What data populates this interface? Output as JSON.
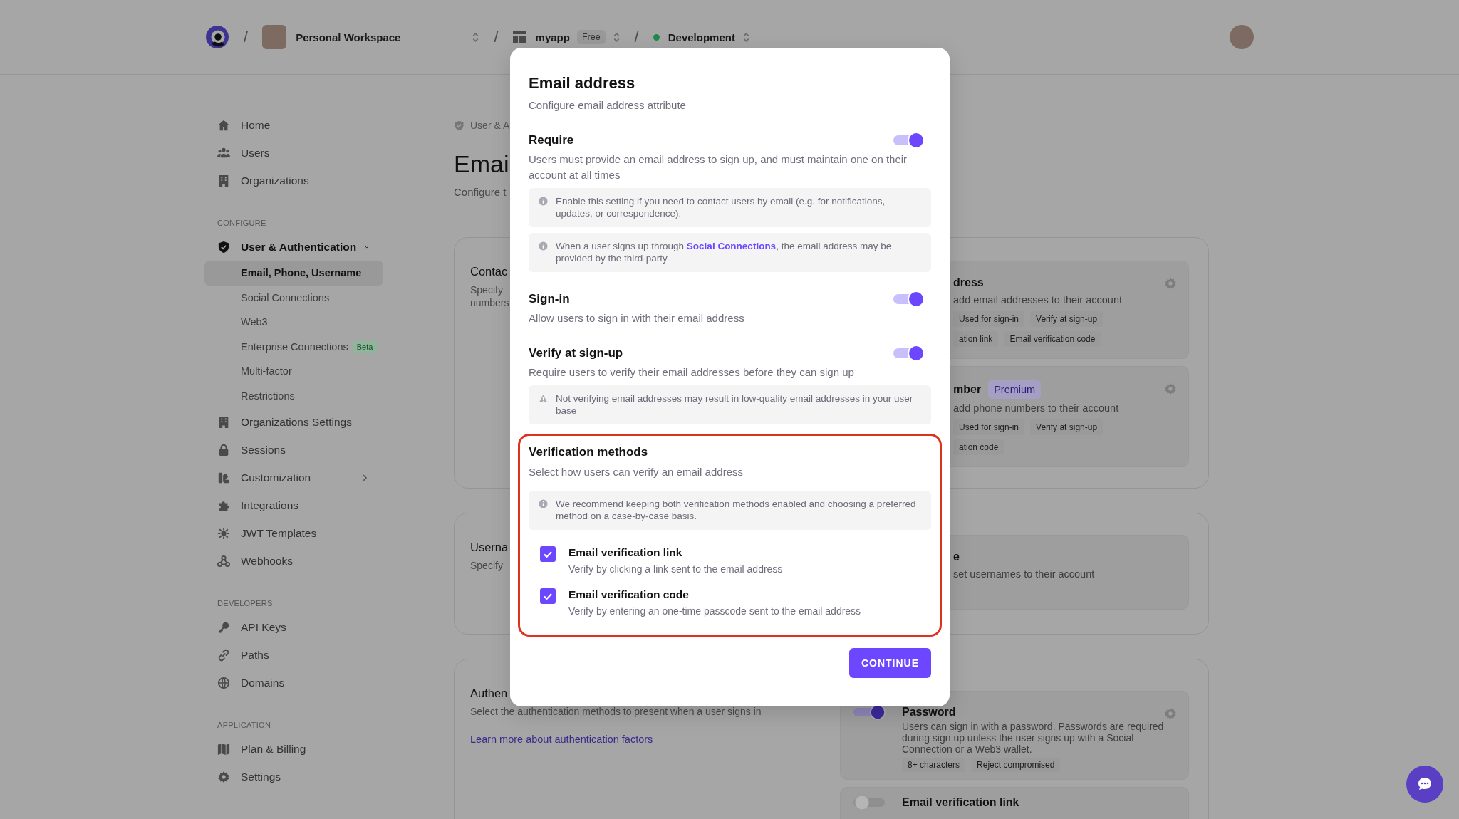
{
  "top_bar": {
    "separators": [
      "/",
      "/",
      "/"
    ],
    "workspace": "Personal Workspace",
    "app": "myapp",
    "plan_badge": "Free",
    "environment": "Development"
  },
  "sidebar": {
    "groups": [
      {
        "items": [
          {
            "label": "Home",
            "selected": false
          },
          {
            "label": "Users",
            "selected": false
          },
          {
            "label": "Organizations",
            "selected": false
          }
        ]
      },
      {
        "heading": "CONFIGURE",
        "items": [
          {
            "label": "User & Authentication",
            "selected": false,
            "expanded": true,
            "children": [
              {
                "label": "Email, Phone, Username",
                "selected": true
              },
              {
                "label": "Social Connections",
                "selected": false
              },
              {
                "label": "Web3",
                "selected": false
              },
              {
                "label": "Enterprise Connections",
                "selected": false,
                "badge": "Beta"
              },
              {
                "label": "Multi-factor",
                "selected": false
              },
              {
                "label": "Restrictions",
                "selected": false
              }
            ]
          },
          {
            "label": "Organizations Settings",
            "selected": false
          },
          {
            "label": "Sessions",
            "selected": false
          },
          {
            "label": "Customization",
            "selected": false,
            "expanded": false
          },
          {
            "label": "Integrations",
            "selected": false
          },
          {
            "label": "JWT Templates",
            "selected": false
          },
          {
            "label": "Webhooks",
            "selected": false
          }
        ]
      },
      {
        "heading": "DEVELOPERS",
        "items": [
          {
            "label": "API Keys",
            "selected": false
          },
          {
            "label": "Paths",
            "selected": false
          },
          {
            "label": "Domains",
            "selected": false
          }
        ]
      },
      {
        "heading": "APPLICATION",
        "items": [
          {
            "label": "Plan & Billing",
            "selected": false
          },
          {
            "label": "Settings",
            "selected": false
          }
        ]
      }
    ]
  },
  "page": {
    "breadcrumb": "User & A",
    "title": "Emai",
    "subtitle": "Configure t",
    "cards": [
      {
        "title": "Contac",
        "description_lines": [
          "Specify",
          "numbers"
        ],
        "settings": [
          {
            "kind": "cut",
            "title": "dress",
            "description": "add email addresses to their account",
            "tag_rows": [
              [
                "Used for sign-in",
                "Verify at sign-up"
              ],
              [
                "ation link",
                "Email verification code"
              ]
            ]
          },
          {
            "kind": "cut",
            "title": "mber",
            "badge": "Premium",
            "description": "add phone numbers to their account",
            "tag_rows": [
              [
                "Used for sign-in",
                "Verify at sign-up"
              ],
              [
                "ation code"
              ]
            ]
          }
        ]
      },
      {
        "title": "Userna",
        "description_lines": [
          "Specify"
        ],
        "settings": [
          {
            "kind": "cut",
            "title": "e",
            "description": "set usernames to their account",
            "gear": false
          }
        ]
      },
      {
        "title": "Authen",
        "description_lines": [
          "Select the authentication methods to present when a user signs in"
        ],
        "link": "Learn more about authentication factors",
        "settings": [
          {
            "kind": "full",
            "title": "Password",
            "enabled": true,
            "description": "Users can sign in with a password. Passwords are required during sign up unless the user signs up with a Social Connection or a Web3 wallet.",
            "tag_rows": [
              [
                "8+ characters",
                "Reject compromised"
              ]
            ]
          },
          {
            "kind": "full",
            "title": "Email verification link",
            "enabled": false,
            "gear": false
          }
        ]
      }
    ]
  },
  "modal": {
    "title": "Email address",
    "subtitle": "Configure email address attribute",
    "settings": [
      {
        "label": "Require",
        "on": true,
        "description": "Users must provide an email address to sign up, and must maintain one on their account at all times",
        "notes": [
          {
            "kind": "info",
            "text": "Enable this setting if you need to contact users by email (e.g. for notifications, updates, or correspondence)."
          },
          {
            "kind": "info",
            "text": "When a user signs up through ",
            "link": "Social Connections",
            "text_after": ", the email address may be provided by the third-party."
          }
        ]
      },
      {
        "label": "Sign-in",
        "on": true,
        "description": "Allow users to sign in with their email address"
      },
      {
        "label": "Verify at sign-up",
        "on": true,
        "description": "Require users to verify their email addresses before they can sign up",
        "notes": [
          {
            "kind": "warning",
            "text": "Not verifying email addresses may result in low-quality email addresses in your user base"
          }
        ]
      }
    ],
    "verification": {
      "highlighted": true,
      "title": "Verification methods",
      "subtitle": "Select how users can verify an email address",
      "note": {
        "kind": "info",
        "text": "We recommend keeping both verification methods enabled and choosing a preferred method on a case-by-case basis."
      },
      "methods": [
        {
          "label": "Email verification link",
          "description": "Verify by clicking a link sent to the email address",
          "checked": true
        },
        {
          "label": "Email verification code",
          "description": "Verify by entering an one-time passcode sent to the email address",
          "checked": true
        }
      ]
    },
    "continue_button": "CONTINUE"
  }
}
